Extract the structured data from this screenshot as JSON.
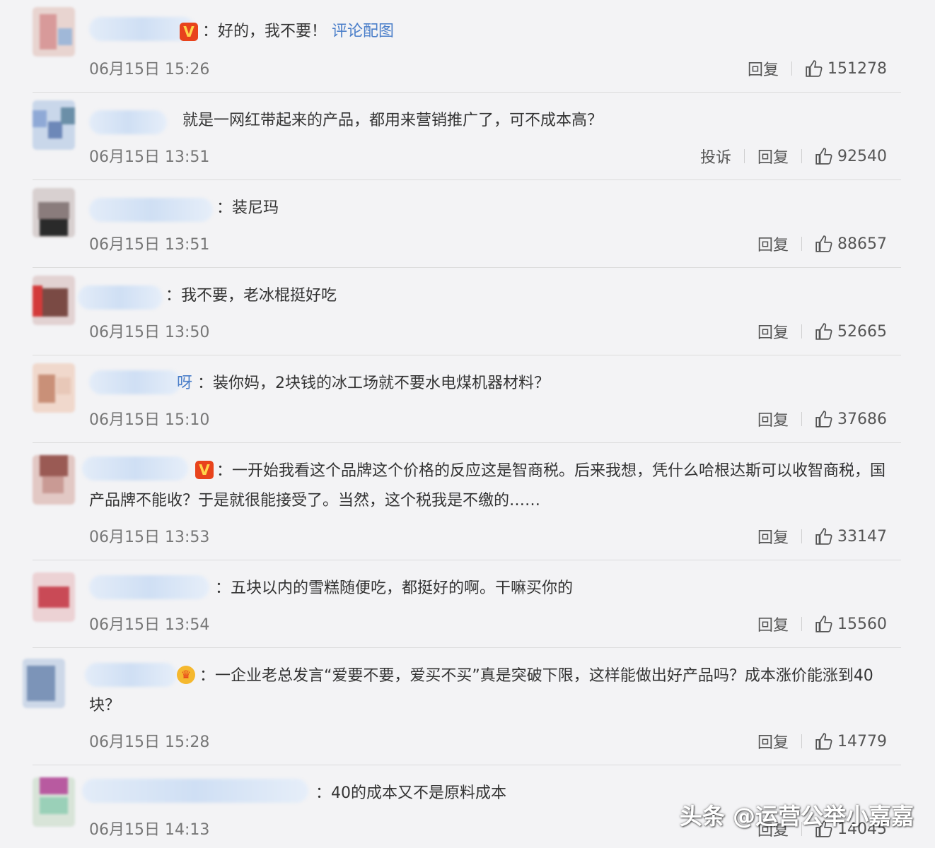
{
  "labels": {
    "reply": "回复",
    "report": "投诉",
    "colon": "：",
    "v_badge": "V"
  },
  "comments": [
    {
      "nick_tail": "",
      "text": "好的，我不要！",
      "link": "评论配图",
      "time": "06月15日 15:26",
      "likes": "151278",
      "badge": "v"
    },
    {
      "nick_tail": "",
      "text": "就是一网红带起来的产品，都用来营销推广了，可不成本高？",
      "time": "06月15日 13:51",
      "likes": "92540",
      "badge": "",
      "report": true
    },
    {
      "nick_tail": "",
      "text": "装尼玛",
      "time": "06月15日 13:51",
      "likes": "88657",
      "badge": ""
    },
    {
      "nick_tail": "",
      "text": "我不要，老冰棍挺好吃",
      "time": "06月15日 13:50",
      "likes": "52665",
      "badge": ""
    },
    {
      "nick_tail": "呀",
      "text": "装你妈，2块钱的冰工场就不要水电煤机器材料？",
      "time": "06月15日 15:10",
      "likes": "37686",
      "badge": ""
    },
    {
      "nick_tail": "",
      "text": "一开始我看这个品牌这个价格的反应这是智商税。后来我想，凭什么哈根达斯可以收智商税，国产品牌不能收？于是就很能接受了。当然，这个税我是不缴的……",
      "time": "06月15日 13:53",
      "likes": "33147",
      "badge": "v"
    },
    {
      "nick_tail": "",
      "text": "五块以内的雪糕随便吃，都挺好的啊。干嘛买你的",
      "time": "06月15日 13:54",
      "likes": "15560",
      "badge": ""
    },
    {
      "nick_tail": "",
      "text": "一企业老总发言“爱要不要，爱买不买”真是突破下限，这样能做出好产品吗？成本涨价能涨到40块？",
      "time": "06月15日 15:28",
      "likes": "14779",
      "badge": "crown"
    },
    {
      "nick_tail": "",
      "text": "40的成本又不是原料成本",
      "time": "06月15日 14:13",
      "likes": "14045",
      "badge": ""
    }
  ],
  "watermark": "头条 @运营公举小嘉嘉",
  "colors": {
    "link": "#4a7ec9",
    "badge_v": "#e8431c",
    "badge_crown": "#f5b82e"
  }
}
